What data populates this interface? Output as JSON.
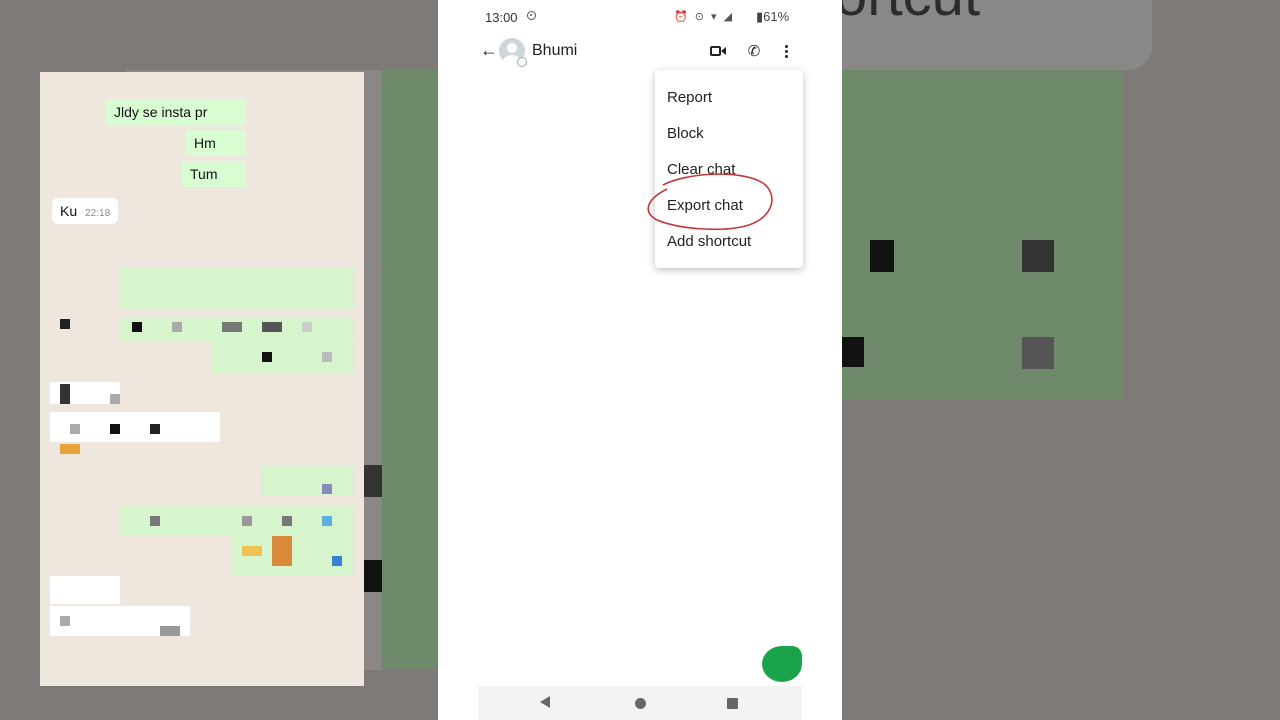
{
  "status_bar": {
    "time": "13:00",
    "indicators": "⏰ ⊙ ▾ ◢",
    "battery": "61%"
  },
  "app_bar": {
    "contact_name": "Bhumi"
  },
  "messages": [
    {
      "text": "Jldy se insta pr"
    },
    {
      "text": "Hm"
    },
    {
      "text": "Tum"
    },
    {
      "text": "Ku",
      "time": "22:18"
    }
  ],
  "menu": {
    "items": [
      "Report",
      "Block",
      "Clear chat",
      "Export chat",
      "Add shortcut"
    ]
  },
  "background": {
    "partial_text": "ortcut"
  },
  "colors": {
    "outgoing_bubble": "#d9fdd3",
    "chat_background": "#efe7dd",
    "annotation_circle": "#c0393b",
    "send_button": "#1aa34a"
  }
}
